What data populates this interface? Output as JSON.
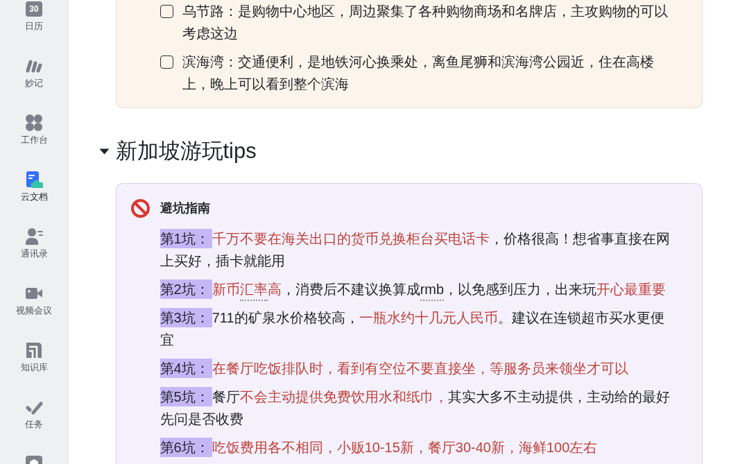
{
  "sidebar": {
    "items": [
      {
        "label": "日历",
        "icon_text": "30",
        "selected": false
      },
      {
        "label": "妙记",
        "selected": false
      },
      {
        "label": "工作台",
        "selected": false
      },
      {
        "label": "云文档",
        "selected": true
      },
      {
        "label": "通讯录",
        "selected": false
      },
      {
        "label": "视频会议",
        "selected": false
      },
      {
        "label": "知识库",
        "selected": false
      },
      {
        "label": "任务",
        "selected": false
      },
      {
        "selected": false
      }
    ]
  },
  "checklist_callout": {
    "items": [
      {
        "text": "乌节路：是购物中心地区，周边聚集了各种购物商场和名牌店，主攻购物的可以考虑这边",
        "checked": false
      },
      {
        "text": "滨海湾：交通便利，是地铁河心换乘处，离鱼尾狮和滨海湾公园近，住在高楼上，晚上可以看到整个滨海",
        "checked": false
      }
    ]
  },
  "section": {
    "title": "新加坡游玩tips",
    "expanded": true,
    "callout": {
      "title": "避坑指南",
      "tips": [
        {
          "label": "第1坑：",
          "segments": [
            {
              "text": "千万不要在海关出口的货币兑换柜台买电话卡",
              "kind": "emphasis",
              "flagged": false
            },
            {
              "text": "，价格很高！想省事直接在网上买好，插卡就能用",
              "kind": "plain",
              "flagged": false
            }
          ]
        },
        {
          "label": "第2坑：",
          "segments": [
            {
              "text": "新币",
              "kind": "emphasis",
              "flagged": false
            },
            {
              "text": "汇率",
              "kind": "emphasis",
              "flagged": true
            },
            {
              "text": "高",
              "kind": "emphasis",
              "flagged": false
            },
            {
              "text": "，消费后不建议换算成",
              "kind": "plain",
              "flagged": false
            },
            {
              "text": "rmb",
              "kind": "plain",
              "flagged": true
            },
            {
              "text": "，以免感到压力，出来玩",
              "kind": "plain",
              "flagged": false
            },
            {
              "text": "开心最重要",
              "kind": "emphasis",
              "flagged": false
            }
          ]
        },
        {
          "label": "第3坑：",
          "segments": [
            {
              "text": "711的矿泉水价格较高，",
              "kind": "plain",
              "flagged": false
            },
            {
              "text": "一瓶水约十几元人民币",
              "kind": "emphasis",
              "flagged": false
            },
            {
              "text": "。建议在连锁超市买水更便宜",
              "kind": "plain",
              "flagged": false
            }
          ]
        },
        {
          "label": "第4坑：",
          "segments": [
            {
              "text": "在餐厅吃饭排队时，看到有空位不要直接坐，等服务员来领坐才可以",
              "kind": "emphasis",
              "flagged": false
            }
          ]
        },
        {
          "label": "第5坑：",
          "segments": [
            {
              "text": "餐厅",
              "kind": "plain",
              "flagged": false
            },
            {
              "text": "不会主动提供免费饮用水和纸巾，",
              "kind": "emphasis",
              "flagged": false
            },
            {
              "text": "其实大多不主动提供，主动给的最好先问是否收费",
              "kind": "plain",
              "flagged": false
            }
          ]
        },
        {
          "label": "第6坑：",
          "segments": [
            {
              "text": "吃饭费用各不相同，小贩10-15新，餐厅30-40新，海鲜100左右",
              "kind": "emphasis",
              "flagged": false
            }
          ]
        }
      ]
    }
  }
}
